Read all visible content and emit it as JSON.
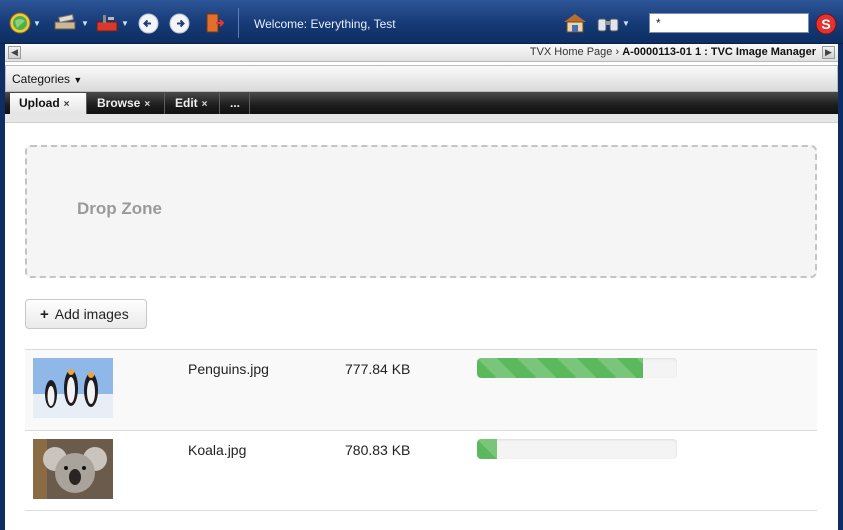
{
  "toolbar": {
    "welcome": "Welcome: Everything, Test",
    "search_value": "*",
    "icons": [
      "home-globe-icon",
      "tools-icon",
      "toolbox-icon",
      "back-icon",
      "forward-icon",
      "logout-door-icon",
      "house-icon",
      "binoculars-icon",
      "search-go-icon"
    ]
  },
  "breadcrumb": {
    "home": "TVX Home Page",
    "separator": "›",
    "current": "A-0000113-01 1 : TVC Image Manager"
  },
  "categories": {
    "label": "Categories"
  },
  "tabs": [
    {
      "label": "Upload",
      "close": "×"
    },
    {
      "label": "Browse",
      "close": "×"
    },
    {
      "label": "Edit",
      "close": "×"
    },
    {
      "label": "...",
      "close": ""
    }
  ],
  "dropzone": {
    "label": "Drop Zone"
  },
  "add_button": {
    "label": "Add images",
    "plus": "+"
  },
  "files": [
    {
      "name": "Penguins.jpg",
      "size": "777.84 KB",
      "progress": 0.83
    },
    {
      "name": "Koala.jpg",
      "size": "780.83 KB",
      "progress": 0.1
    }
  ],
  "colors": {
    "progress": "#5cb85c",
    "topbar": "#163a76"
  }
}
